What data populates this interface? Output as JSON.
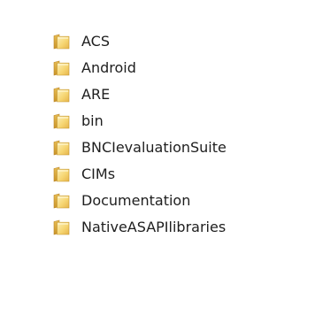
{
  "folders": [
    {
      "name": "ACS",
      "icon": "folder-icon"
    },
    {
      "name": "Android",
      "icon": "folder-icon"
    },
    {
      "name": "ARE",
      "icon": "folder-icon"
    },
    {
      "name": "bin",
      "icon": "folder-icon"
    },
    {
      "name": "BNCIevaluationSuite",
      "icon": "folder-icon"
    },
    {
      "name": "CIMs",
      "icon": "folder-icon"
    },
    {
      "name": "Documentation",
      "icon": "folder-icon"
    },
    {
      "name": "NativeASAPIlibraries",
      "icon": "folder-icon"
    }
  ],
  "colors": {
    "folder_back": "#d9a838",
    "folder_front": "#f6d673",
    "folder_highlight": "#fcefb7",
    "text": "#1e1e1e"
  }
}
